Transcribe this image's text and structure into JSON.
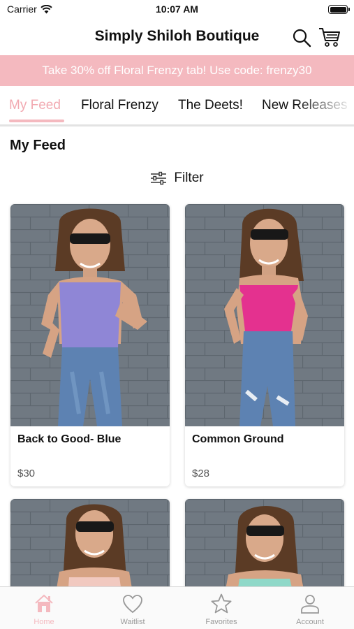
{
  "status_bar": {
    "carrier": "Carrier",
    "time": "10:07 AM"
  },
  "header": {
    "title": "Simply Shiloh Boutique"
  },
  "promo": {
    "text": "Take 30% off Floral Frenzy tab! Use code: frenzy30"
  },
  "tabs": [
    {
      "label": "My Feed",
      "active": true
    },
    {
      "label": "Floral Frenzy",
      "active": false
    },
    {
      "label": "The Deets!",
      "active": false
    },
    {
      "label": "New Releases",
      "active": false
    }
  ],
  "feed": {
    "title": "My Feed",
    "filter_label": "Filter",
    "products": [
      {
        "name": "Back to Good- Blue",
        "price": "$30",
        "top_color": "#8f86d6"
      },
      {
        "name": "Common Ground",
        "price": "$28",
        "top_color": "#e4318f"
      },
      {
        "name": "",
        "price": "",
        "top_color": "#f1c9c0"
      },
      {
        "name": "",
        "price": "",
        "top_color": "#8fd8c8"
      }
    ]
  },
  "bottom_nav": [
    {
      "label": "Home",
      "icon": "home-icon",
      "active": true
    },
    {
      "label": "Waitlist",
      "icon": "heart-icon",
      "active": false
    },
    {
      "label": "Favorites",
      "icon": "star-icon",
      "active": false
    },
    {
      "label": "Account",
      "icon": "person-icon",
      "active": false
    }
  ],
  "colors": {
    "accent": "#f4b9bf",
    "wall": "#6f7880"
  }
}
